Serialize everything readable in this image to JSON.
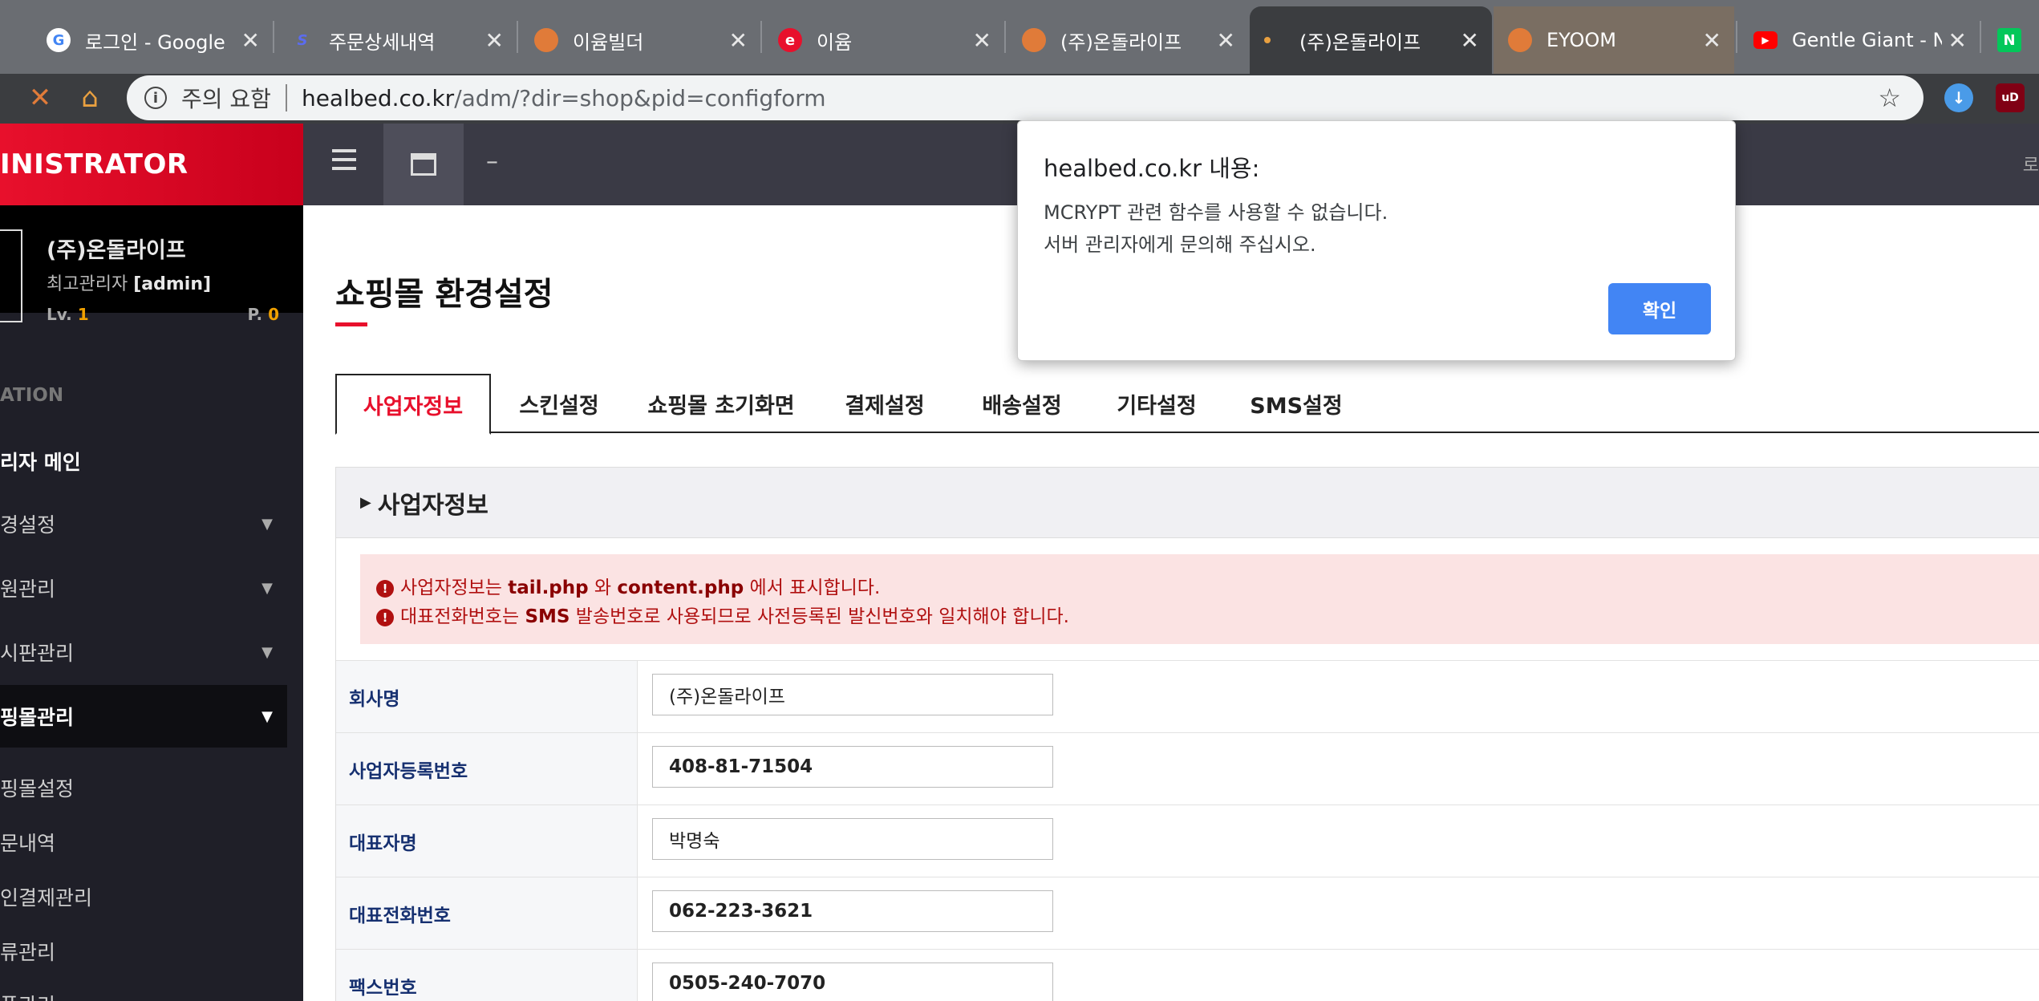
{
  "browser": {
    "tabs": [
      {
        "title": "로그인 - Google",
        "favicon": "google-icon",
        "color": "#4285f4"
      },
      {
        "title": "주문상세내역",
        "favicon": "sw-logo-icon",
        "color": "#5b6cf0"
      },
      {
        "title": "이윰빌더",
        "favicon": "globe-icon",
        "color": "#e07b39"
      },
      {
        "title": "이윰",
        "favicon": "e-logo-icon",
        "color": "#e8102c"
      },
      {
        "title": "(주)온돌라이프",
        "favicon": "globe-icon",
        "color": "#e07b39"
      },
      {
        "title": "(주)온돌라이프",
        "favicon": "loading-icon",
        "color": "#e8a040"
      },
      {
        "title": "EYOOM",
        "favicon": "globe-icon",
        "color": "#e07b39"
      },
      {
        "title": "Gentle Giant - N",
        "favicon": "youtube-icon",
        "color": "#ff0000"
      },
      {
        "title": "",
        "favicon": "naver-icon",
        "color": "#03c75a"
      }
    ],
    "favicon_letters": {
      "e": "e",
      "naver": "N"
    },
    "security_warning": "주의 요함",
    "url_host": "healbed.co.kr",
    "url_path": "/adm/?dir=shop&pid=configform"
  },
  "sidebar": {
    "brand": "INISTRATOR",
    "profile_name": "(주)온돌라이프",
    "profile_role": "최고관리자",
    "profile_id": "[admin]",
    "level_label": "Lv.",
    "level_value": "1",
    "point_label": "P.",
    "point_value": "0",
    "section": "ATION",
    "items": [
      "리자 메인",
      "경설정",
      "원관리",
      "시판관리",
      "핑몰관리"
    ],
    "subitems": [
      "핑몰설정",
      "문내역",
      "인결제관리",
      "류관리",
      "품관리"
    ]
  },
  "topbar": {
    "right_text": "로"
  },
  "page": {
    "title": "쇼핑몰 환경설정",
    "tabs": [
      "사업자정보",
      "스킨설정",
      "쇼핑몰 초기화면",
      "결제설정",
      "배송설정",
      "기타설정",
      "SMS설정"
    ],
    "panel_title": "사업자정보",
    "alert": {
      "line1_a": "사업자정보는",
      "line1_b": "tail.php",
      "line1_c": "와",
      "line1_d": "content.php",
      "line1_e": "에서 표시합니다.",
      "line2_a": "대표전화번호는",
      "line2_b": "SMS",
      "line2_c": "발송번호로 사용되므로 사전등록된 발신번호와 일치해야 합니다."
    },
    "fields": [
      {
        "label": "회사명",
        "value": "(주)온돌라이프"
      },
      {
        "label": "사업자등록번호",
        "value": "408-81-71504"
      },
      {
        "label": "대표자명",
        "value": "박명숙"
      },
      {
        "label": "대표전화번호",
        "value": "062-223-3621"
      },
      {
        "label": "팩스번호",
        "value": "0505-240-7070"
      }
    ]
  },
  "dialog": {
    "title": "healbed.co.kr 내용:",
    "line1": "MCRYPT 관련 함수를 사용할 수 없습니다.",
    "line2": "서버 관리자에게 문의해 주십시오.",
    "confirm": "확인"
  }
}
